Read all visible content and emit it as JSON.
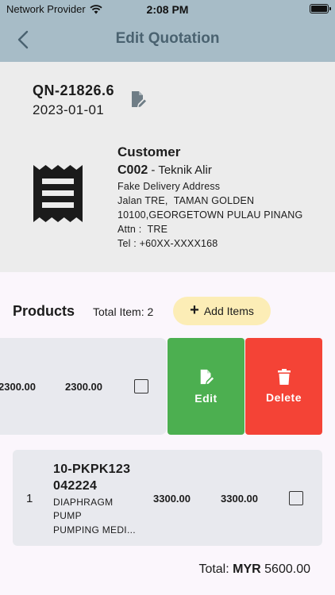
{
  "status_bar": {
    "carrier": "Network Provider",
    "time": "2:08 PM"
  },
  "nav": {
    "title": "Edit Quotation",
    "back_icon": "chevron-left-icon"
  },
  "quotation": {
    "number": "QN-21826.6",
    "date": "2023-01-01"
  },
  "customer": {
    "heading": "Customer",
    "code": "C002",
    "separator": " - ",
    "name": "Teknik Alir",
    "address_lines": [
      "Fake Delivery Address",
      "Jalan TRE,  TAMAN GOLDEN",
      "10100,GEORGETOWN PULAU PINANG",
      "Attn :  TRE",
      "Tel : +60XX-XXXX168"
    ]
  },
  "products": {
    "title": "Products",
    "total_item": "Total Item: 2",
    "add_button": "Add Items",
    "rows": [
      {
        "unit_price": "2300.00",
        "amount": "2300.00"
      },
      {
        "index": "1",
        "code_line1": "10-PKPK123",
        "code_line2": "042224",
        "desc_lines": [
          "DIAPHRAGM",
          "PUMP",
          "PUMPING MEDI..."
        ],
        "unit_price": "3300.00",
        "amount": "3300.00"
      }
    ],
    "actions": {
      "edit": "Edit",
      "delete": "Delete"
    }
  },
  "total": {
    "label": "Total:",
    "currency": "MYR",
    "value": "5600.00"
  },
  "colors": {
    "nav": "#a7bcc7",
    "edit": "#4caf50",
    "delete": "#f44336",
    "add": "#fcedb6"
  }
}
